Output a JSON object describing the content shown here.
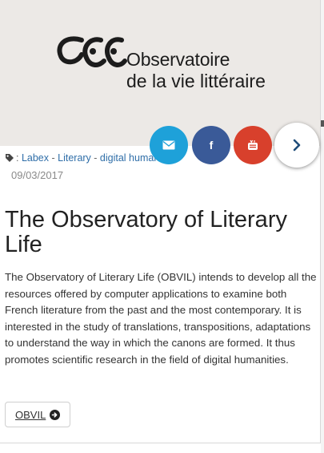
{
  "logo": {
    "line1": "Observatoire",
    "line2": "de la vie littéraire"
  },
  "share": {
    "mail_icon": "envelope-icon",
    "facebook_icon": "f",
    "youtube_icon": "youtube-icon",
    "next_icon": "chevron-right-icon",
    "colors": {
      "mail": "#1ea1d9",
      "facebook": "#3a5a98",
      "youtube": "#d8402c"
    }
  },
  "tags": {
    "prefix": ": ",
    "items": [
      "Labex",
      "Literary",
      "digital humanities"
    ],
    "separator": " - "
  },
  "post": {
    "date": "09/03/2017",
    "title": "The Observatory of Literary Life",
    "description": "The Observatory of Literary Life (OBVIL) intends to develop all the resources offered by computer applications to examine both French literature from the past and the most contemporary. It is interested in the study of translations, transpositions, adaptations to understand the way in which the canons are formed. It thus promotes scientific research in the field of digital humanities.",
    "button_label": "OBVIL"
  }
}
